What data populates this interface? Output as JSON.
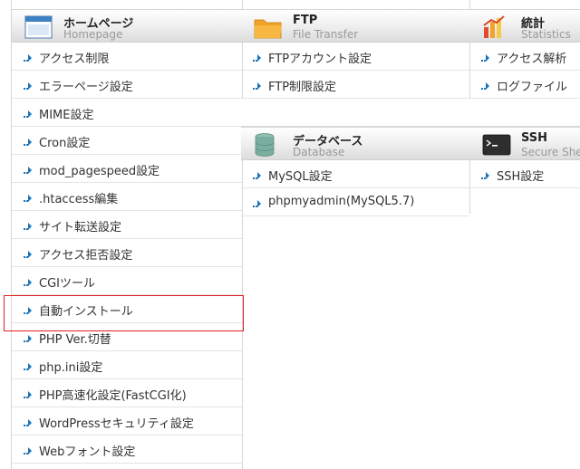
{
  "homepage": {
    "title": "ホームページ",
    "subtitle": "Homepage",
    "icon": "homepage-window-icon",
    "items": [
      {
        "label": "アクセス制限"
      },
      {
        "label": "エラーページ設定"
      },
      {
        "label": "MIME設定"
      },
      {
        "label": "Cron設定"
      },
      {
        "label": "mod_pagespeed設定"
      },
      {
        "label": ".htaccess編集"
      },
      {
        "label": "サイト転送設定"
      },
      {
        "label": "アクセス拒否設定"
      },
      {
        "label": "CGIツール"
      },
      {
        "label": "自動インストール"
      },
      {
        "label": "PHP Ver.切替"
      },
      {
        "label": "php.ini設定"
      },
      {
        "label": "PHP高速化設定(FastCGI化)"
      },
      {
        "label": "WordPressセキュリティ設定"
      },
      {
        "label": "Webフォント設定"
      }
    ]
  },
  "ftp": {
    "title": "FTP",
    "subtitle": "File Transfer",
    "icon": "folder-icon",
    "items": [
      {
        "label": "FTPアカウント設定"
      },
      {
        "label": "FTP制限設定"
      }
    ]
  },
  "database": {
    "title": "データベース",
    "subtitle": "Database",
    "icon": "database-icon",
    "items": [
      {
        "label": "MySQL設定"
      },
      {
        "label": "phpmyadmin(MySQL5.7)"
      }
    ]
  },
  "statistics": {
    "title": "統計",
    "subtitle": "Statistics",
    "icon": "bar-chart-icon",
    "items": [
      {
        "label": "アクセス解析"
      },
      {
        "label": "ログファイル"
      }
    ]
  },
  "ssh": {
    "title": "SSH",
    "subtitle": "Secure Shell",
    "icon": "terminal-icon",
    "items": [
      {
        "label": "SSH設定"
      }
    ]
  },
  "colors": {
    "highlight": "#e02020",
    "arrow": "#1a73b8",
    "subtitle": "#9a9a9a"
  }
}
